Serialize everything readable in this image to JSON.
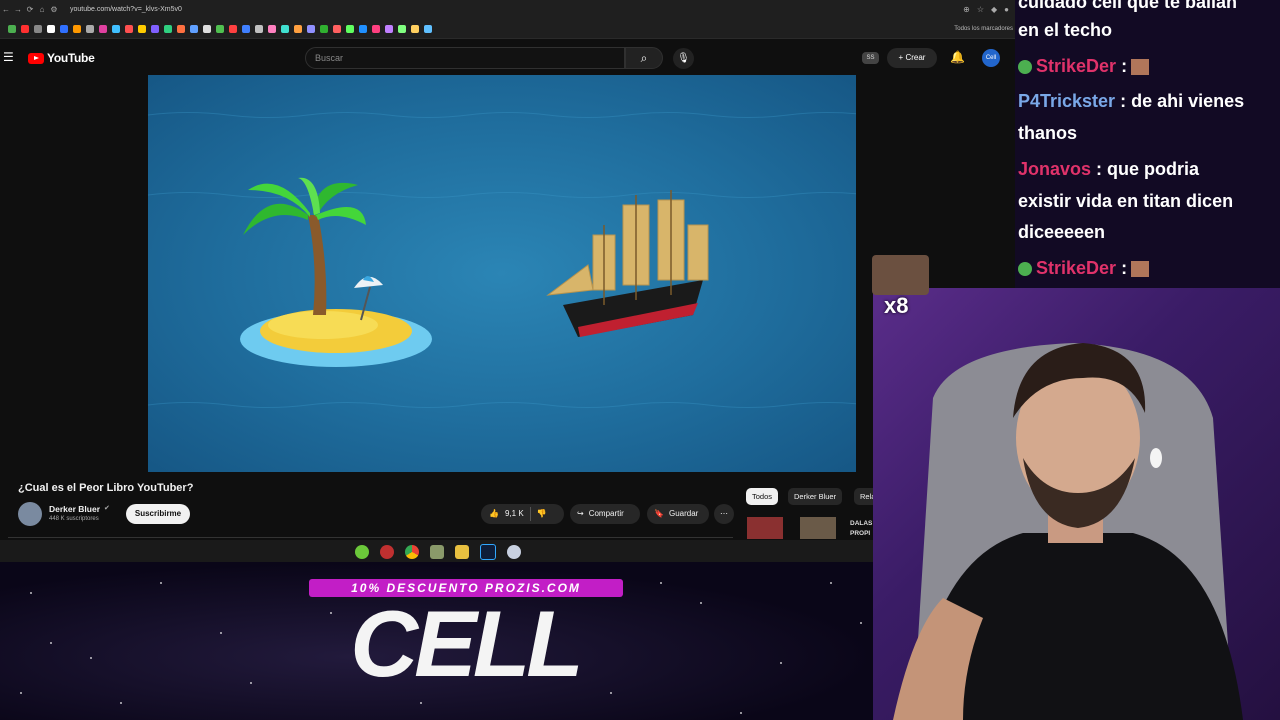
{
  "browser": {
    "url": "youtube.com/watch?v=_klvs-Xm5v0",
    "bookmarks_folder": "Todos los marcadores",
    "bookmark_colors": [
      "#4caf50",
      "#ff3030",
      "#888888",
      "#ffffff",
      "#3070ff",
      "#ff9900",
      "#aaaaaa",
      "#e040a0",
      "#40c0ff",
      "#ff5050",
      "#ffcc00",
      "#8060ff",
      "#30d080",
      "#ff7040",
      "#60a0ff",
      "#dddddd",
      "#50c050",
      "#ff4040",
      "#4080ff",
      "#c0c0c0",
      "#ff80c0",
      "#40e0d0",
      "#ffa040",
      "#9090ff",
      "#30b030",
      "#ff6060",
      "#60ff60",
      "#2090ff",
      "#ff4080",
      "#c080ff",
      "#80ff80",
      "#ffd060",
      "#60c0ff"
    ]
  },
  "youtube": {
    "logo_text": "YouTube",
    "search_placeholder": "Buscar",
    "ss_badge": "SS",
    "create_label": "Crear",
    "avatar_label": "Cell"
  },
  "video": {
    "title": "¿Cual es el Peor Libro YouTuber?",
    "channel_name": "Derker Bluer",
    "subscribers": "448 K suscriptores",
    "subscribe_label": "Suscribirme",
    "likes": "9,1 K",
    "share_label": "Compartir",
    "save_label": "Guardar"
  },
  "recommendations": {
    "chips": [
      "Todos",
      "Derker Bluer",
      "Rela"
    ],
    "rec_text_line1": "DALAS",
    "rec_text_line2": "PROPI"
  },
  "stream_overlay": {
    "promo": "10% DESCUENTO PROZIS.COM",
    "brand": "CELL",
    "emote_multiplier": "x8"
  },
  "chat": {
    "messages": [
      {
        "text": "cuidado cell que te bailan"
      },
      {
        "text": "en el techo"
      },
      {
        "user": "StrikeDer",
        "text": ":"
      },
      {
        "user": "P4Trickster",
        "text": ": de ahi vienes"
      },
      {
        "text": "thanos"
      },
      {
        "user": "Jonavos",
        "text": ": que podria"
      },
      {
        "text": "existir vida en titan dicen"
      },
      {
        "text": "diceeeeen"
      },
      {
        "user": "StrikeDer",
        "text": ":"
      }
    ]
  },
  "colors": {
    "youtube_red": "#ff0000",
    "promo_magenta": "#c21ec6",
    "chat_bg": "#120a24"
  }
}
